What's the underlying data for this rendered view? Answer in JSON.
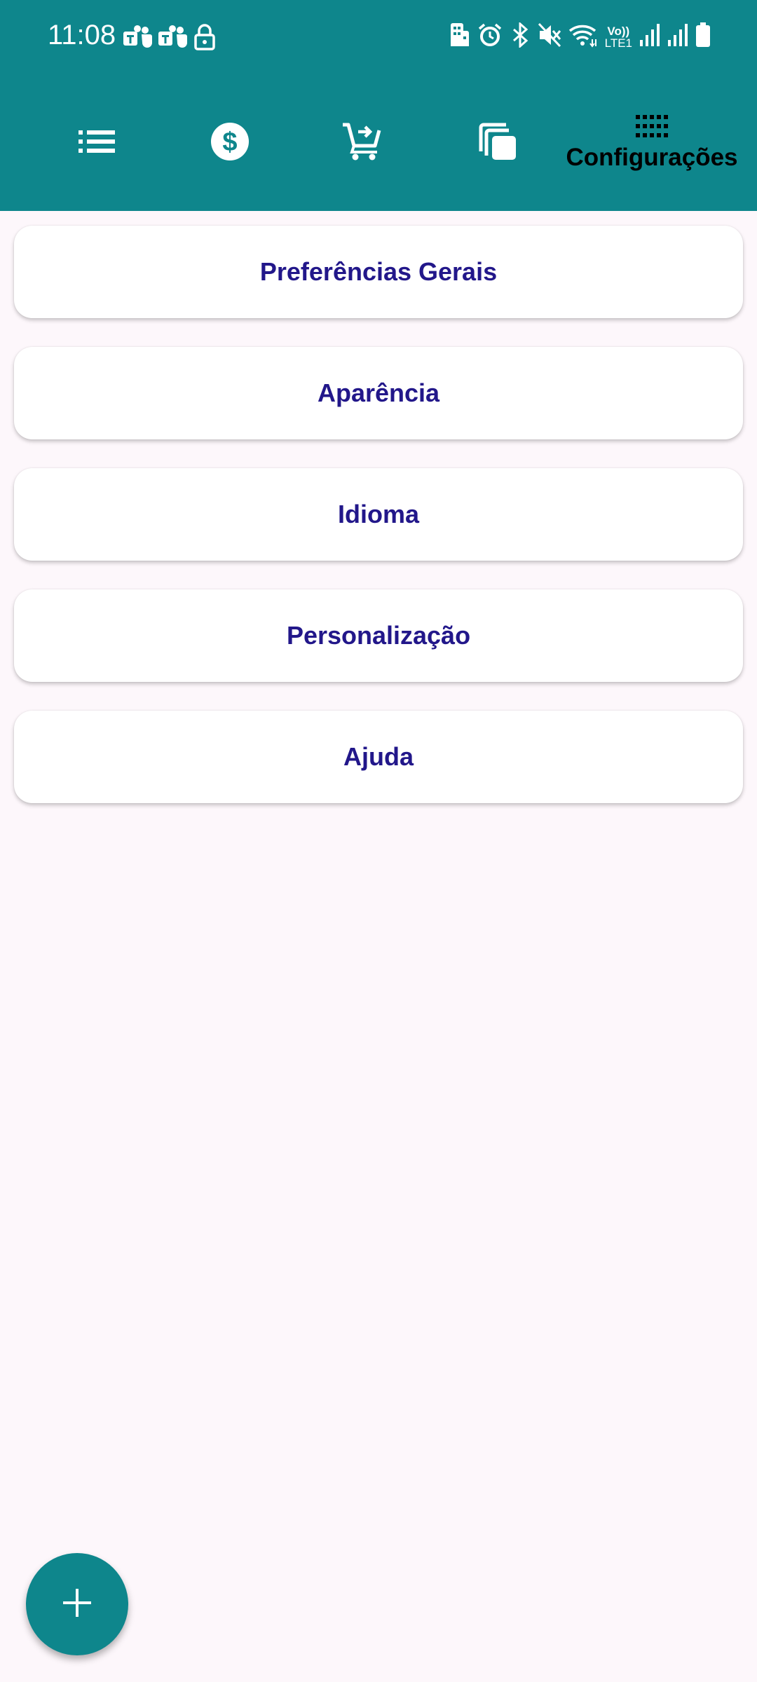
{
  "status_bar": {
    "time": "11:08",
    "left_icons": [
      "teams-icon",
      "teams-icon",
      "lock-icon"
    ],
    "right_icons": [
      "building-icon",
      "alarm-icon",
      "bluetooth-icon",
      "mute-icon",
      "wifi-icon",
      "volte-icon",
      "signal-icon",
      "signal-icon",
      "battery-icon"
    ],
    "volte_label": "Vo))",
    "lte_label": "LTE1"
  },
  "tabs": [
    {
      "icon": "list-icon",
      "label": ""
    },
    {
      "icon": "dollar-icon",
      "label": ""
    },
    {
      "icon": "cart-icon",
      "label": ""
    },
    {
      "icon": "copy-icon",
      "label": ""
    },
    {
      "icon": "grid-icon",
      "label": "Configurações",
      "active": true
    }
  ],
  "settings": [
    {
      "label": "Preferências Gerais"
    },
    {
      "label": "Aparência"
    },
    {
      "label": "Idioma"
    },
    {
      "label": "Personalização"
    },
    {
      "label": "Ajuda"
    }
  ],
  "fab": {
    "icon": "plus-icon"
  },
  "colors": {
    "primary": "#0e868c",
    "background": "#fdf7fb",
    "card_text": "#22178a",
    "active_tab_text": "#000000"
  }
}
